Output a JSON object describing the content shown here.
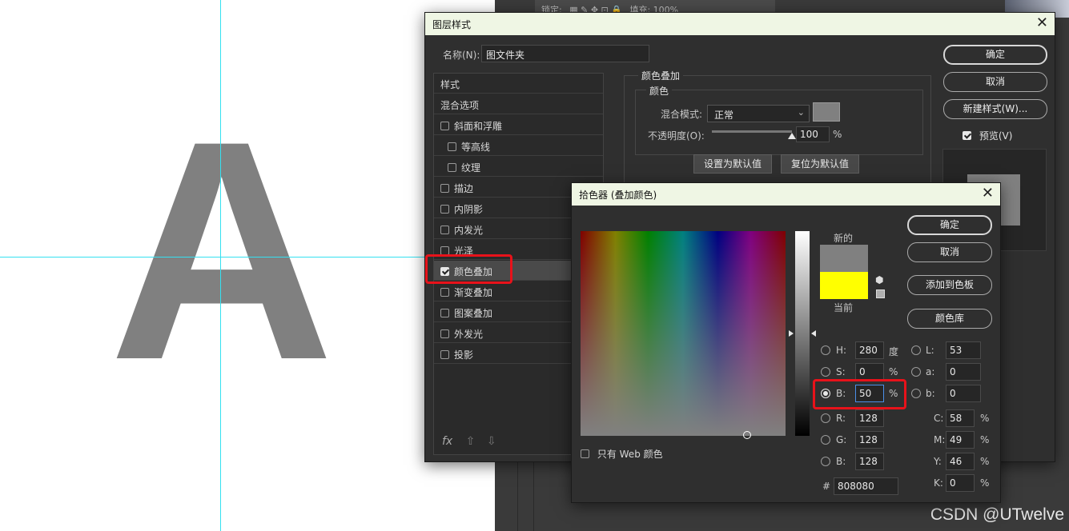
{
  "canvas": {
    "letter": "A",
    "letter_color": "#808080",
    "guide_color": "#35e0f0"
  },
  "watermark": "CSDN @UTwelve",
  "ps_toolbar": {
    "lock_label": "锁定:",
    "fill_label": "填充:",
    "fill_value": "100%"
  },
  "layer_style": {
    "title": "图层样式",
    "name_label": "名称(N):",
    "name_value": "图文件夹",
    "buttons": {
      "ok": "确定",
      "cancel": "取消",
      "new_style": "新建样式(W)..."
    },
    "preview_label": "预览(V)",
    "preview_checked": true,
    "styles": [
      {
        "label": "样式",
        "checkbox": false,
        "checked": false,
        "sub": false,
        "selected": false
      },
      {
        "label": "混合选项",
        "checkbox": false,
        "checked": false,
        "sub": false,
        "selected": false
      },
      {
        "label": "斜面和浮雕",
        "checkbox": true,
        "checked": false,
        "sub": false,
        "selected": false
      },
      {
        "label": "等高线",
        "checkbox": true,
        "checked": false,
        "sub": true,
        "selected": false
      },
      {
        "label": "纹理",
        "checkbox": true,
        "checked": false,
        "sub": true,
        "selected": false
      },
      {
        "label": "描边",
        "checkbox": true,
        "checked": false,
        "sub": false,
        "selected": false
      },
      {
        "label": "内阴影",
        "checkbox": true,
        "checked": false,
        "sub": false,
        "selected": false
      },
      {
        "label": "内发光",
        "checkbox": true,
        "checked": false,
        "sub": false,
        "selected": false
      },
      {
        "label": "光泽",
        "checkbox": true,
        "checked": false,
        "sub": false,
        "selected": false
      },
      {
        "label": "颜色叠加",
        "checkbox": true,
        "checked": true,
        "sub": false,
        "selected": true
      },
      {
        "label": "渐变叠加",
        "checkbox": true,
        "checked": false,
        "sub": false,
        "selected": false
      },
      {
        "label": "图案叠加",
        "checkbox": true,
        "checked": false,
        "sub": false,
        "selected": false
      },
      {
        "label": "外发光",
        "checkbox": true,
        "checked": false,
        "sub": false,
        "selected": false
      },
      {
        "label": "投影",
        "checkbox": true,
        "checked": false,
        "sub": false,
        "selected": false
      }
    ],
    "footer": {
      "fx": "fx",
      "up": "⇧",
      "down": "⇩"
    },
    "panel": {
      "group_title": "颜色叠加",
      "sub_title": "颜色",
      "blend_label": "混合模式:",
      "blend_value": "正常",
      "opacity_label": "不透明度(O):",
      "opacity_value": "100",
      "opacity_unit": "%",
      "opacity_level": 1.0,
      "set_default": "设置为默认值",
      "reset_default": "复位为默认值",
      "overlay_color": "#808080"
    }
  },
  "color_picker": {
    "title": "拾色器 (叠加颜色)",
    "buttons": {
      "ok": "确定",
      "cancel": "取消",
      "add_swatch": "添加到色板",
      "library": "颜色库"
    },
    "new_label": "新的",
    "current_label": "当前",
    "new_color": "#808080",
    "current_color": "#ffff00",
    "web_only_label": "只有 Web 颜色",
    "web_only_checked": false,
    "hsb": {
      "h": {
        "label": "H:",
        "value": "280",
        "unit": "度"
      },
      "s": {
        "label": "S:",
        "value": "0",
        "unit": "%"
      },
      "b": {
        "label": "B:",
        "value": "50",
        "unit": "%"
      }
    },
    "rgb": {
      "r": {
        "label": "R:",
        "value": "128"
      },
      "g": {
        "label": "G:",
        "value": "128"
      },
      "b": {
        "label": "B:",
        "value": "128"
      }
    },
    "lab": {
      "l": {
        "label": "L:",
        "value": "53"
      },
      "a": {
        "label": "a:",
        "value": "0"
      },
      "b": {
        "label": "b:",
        "value": "0"
      }
    },
    "cmyk": {
      "c": {
        "label": "C:",
        "value": "58",
        "unit": "%"
      },
      "m": {
        "label": "M:",
        "value": "49",
        "unit": "%"
      },
      "y": {
        "label": "Y:",
        "value": "46",
        "unit": "%"
      },
      "k": {
        "label": "K:",
        "value": "0",
        "unit": "%"
      }
    },
    "hex_label": "#",
    "hex_value": "808080",
    "selected_mode": "B"
  },
  "highlight_color": "#e8121a"
}
